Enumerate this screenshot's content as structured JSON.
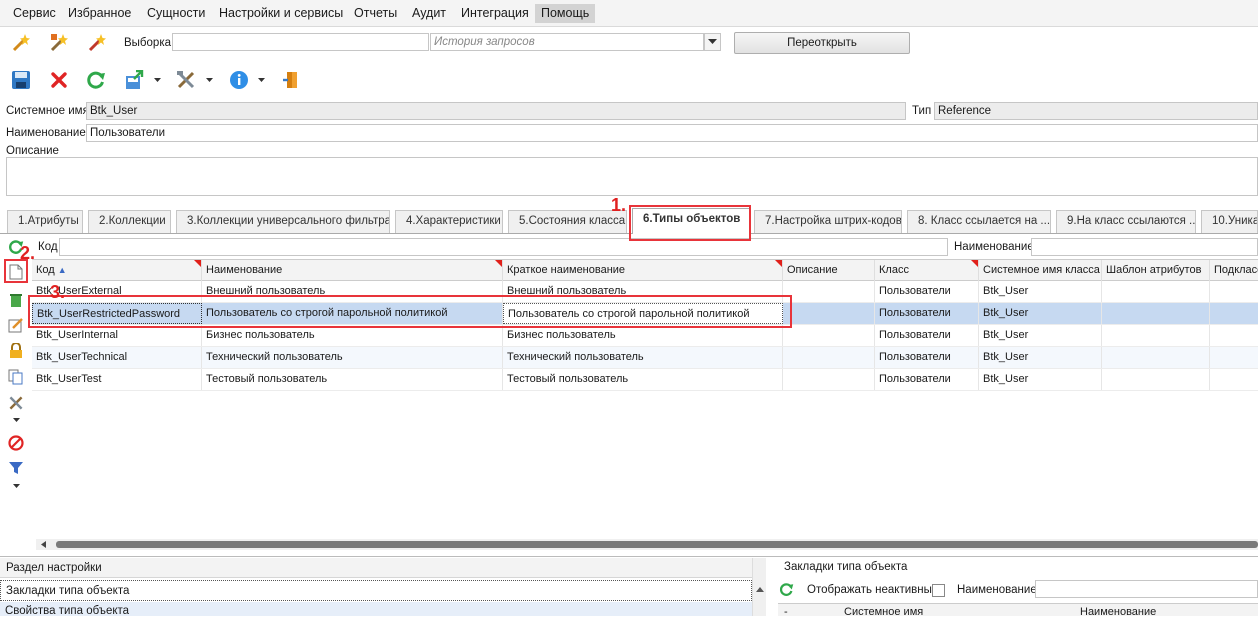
{
  "menu": [
    "Сервис",
    "Избранное",
    "Сущности",
    "Настройки и сервисы",
    "Отчеты",
    "Аудит",
    "Интеграция",
    "Помощь"
  ],
  "toolbar1": {
    "selection_label": "Выборка",
    "selection_value": "",
    "history_placeholder": "История запросов",
    "reopen_button": "Переоткрыть"
  },
  "form": {
    "system_name_label": "Системное имя",
    "system_name_value": "Btk_User",
    "type_label": "Тип",
    "type_value": "Reference",
    "name_label": "Наименование",
    "name_value": "Пользователи",
    "description_label": "Описание",
    "description_value": ""
  },
  "tabs": [
    "1.Атрибуты",
    "2.Коллекции",
    "3.Коллекции универсального фильтра",
    "4.Характеристики",
    "5.Состояния класса",
    "6.Типы объектов",
    "7.Настройка штрих-кодов",
    "8. Класс ссылается на ...",
    "9.На класс ссылаются ...",
    "10.Уника"
  ],
  "filter": {
    "code_label": "Код",
    "name_label": "Наименование"
  },
  "grid": {
    "columns": [
      "Код",
      "Наименование",
      "Краткое наименование",
      "Описание",
      "Класс",
      "Системное имя класса",
      "Шаблон атрибутов",
      "Подкласс"
    ],
    "rows": [
      [
        "Btk_UserExternal",
        "Внешний пользователь",
        "Внешний пользователь",
        "",
        "Пользователи",
        "Btk_User",
        "",
        ""
      ],
      [
        "Btk_UserRestrictedPassword",
        "Пользователь со строгой парольной политикой",
        "Пользователь со строгой парольной политикой",
        "",
        "Пользователи",
        "Btk_User",
        "",
        ""
      ],
      [
        "Btk_UserInternal",
        "Бизнес пользователь",
        "Бизнес пользователь",
        "",
        "Пользователи",
        "Btk_User",
        "",
        ""
      ],
      [
        "Btk_UserTechnical",
        "Технический пользователь",
        "Технический пользователь",
        "",
        "Пользователи",
        "Btk_User",
        "",
        ""
      ],
      [
        "Btk_UserTest",
        "Тестовый пользователь",
        "Тестовый пользователь",
        "",
        "Пользователи",
        "Btk_User",
        "",
        ""
      ]
    ]
  },
  "annotations": [
    "1.",
    "2.",
    "3."
  ],
  "bottom": {
    "section_header": "Раздел настройки",
    "items": [
      "Закладки типа объекта",
      "Свойства типа объекта"
    ],
    "right_header": "Закладки типа объекта",
    "show_inactive_label": "Отображать неактивные",
    "name_label": "Наименование",
    "col_dash": "-",
    "col_system_name": "Системное имя",
    "col_name": "Наименование"
  },
  "colors": {
    "accent_red": "#e8343a",
    "selection": "#c6d9f1"
  }
}
